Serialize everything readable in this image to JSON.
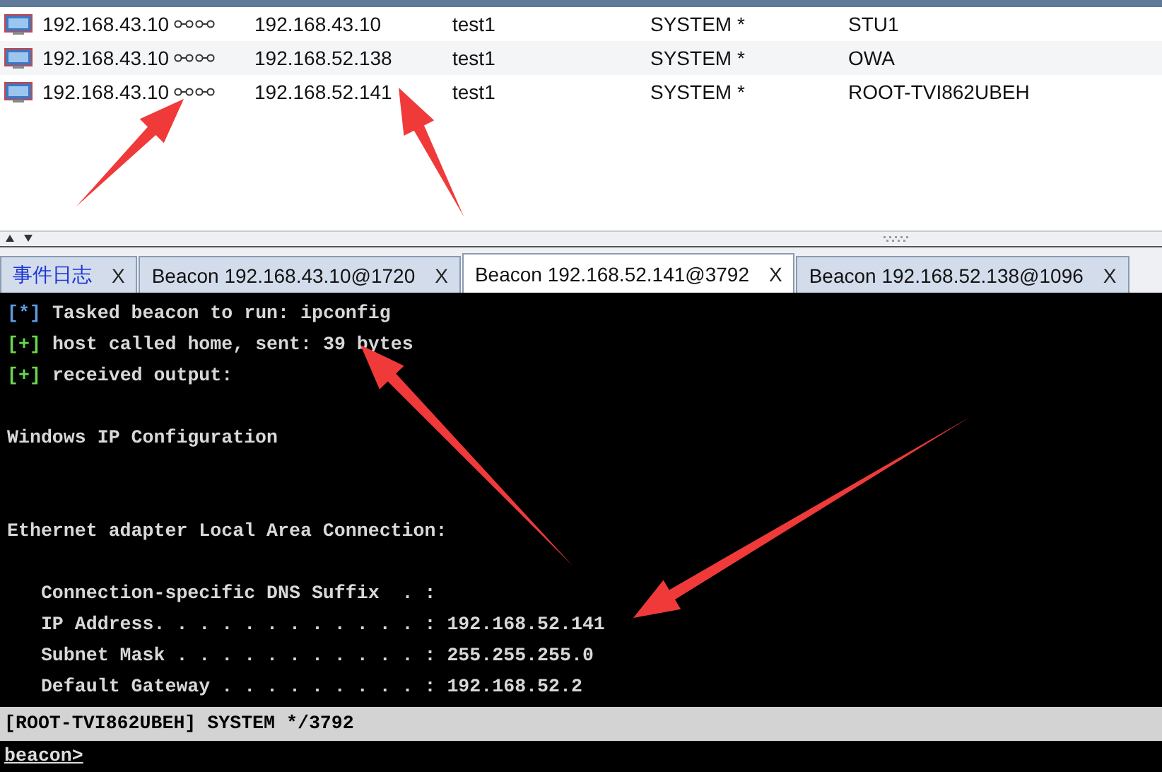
{
  "sessions": [
    {
      "external": "192.168.43.10",
      "internal": "192.168.43.10",
      "user": "test1",
      "process_user": "SYSTEM *",
      "computer": "STU1",
      "selected": false
    },
    {
      "external": "192.168.43.10",
      "internal": "192.168.52.138",
      "user": "test1",
      "process_user": "SYSTEM *",
      "computer": "OWA",
      "selected": false
    },
    {
      "external": "192.168.43.10",
      "internal": "192.168.52.141",
      "user": "test1",
      "process_user": "SYSTEM *",
      "computer": "ROOT-TVI862UBEH",
      "selected": false
    }
  ],
  "tabs": [
    {
      "label": "事件日志",
      "close": "X",
      "kind": "event",
      "selected": false
    },
    {
      "label": "Beacon 192.168.43.10@1720",
      "close": "X",
      "kind": "beacon",
      "selected": false
    },
    {
      "label": "Beacon 192.168.52.141@3792",
      "close": "X",
      "kind": "beacon",
      "selected": true
    },
    {
      "label": "Beacon 192.168.52.138@1096",
      "close": "X",
      "kind": "beacon",
      "selected": false
    }
  ],
  "console": [
    {
      "kind": "task",
      "prefix": "[*]",
      "text": "Tasked beacon to run: ipconfig"
    },
    {
      "kind": "ok",
      "prefix": "[+]",
      "text": "host called home, sent: 39 bytes"
    },
    {
      "kind": "ok",
      "prefix": "[+]",
      "text": "received output:"
    },
    {
      "kind": "blank"
    },
    {
      "kind": "output",
      "text": "Windows IP Configuration"
    },
    {
      "kind": "blank"
    },
    {
      "kind": "blank"
    },
    {
      "kind": "output",
      "text": "Ethernet adapter Local Area Connection:"
    },
    {
      "kind": "blank"
    },
    {
      "kind": "output",
      "text": "   Connection-specific DNS Suffix  . :"
    },
    {
      "kind": "output",
      "text": "   IP Address. . . . . . . . . . . . : 192.168.52.141"
    },
    {
      "kind": "output",
      "text": "   Subnet Mask . . . . . . . . . . . : 255.255.255.0"
    },
    {
      "kind": "output",
      "text": "   Default Gateway . . . . . . . . . : 192.168.52.2"
    }
  ],
  "status_bar": "[ROOT-TVI862UBEH] SYSTEM */3792",
  "prompt": "beacon>"
}
